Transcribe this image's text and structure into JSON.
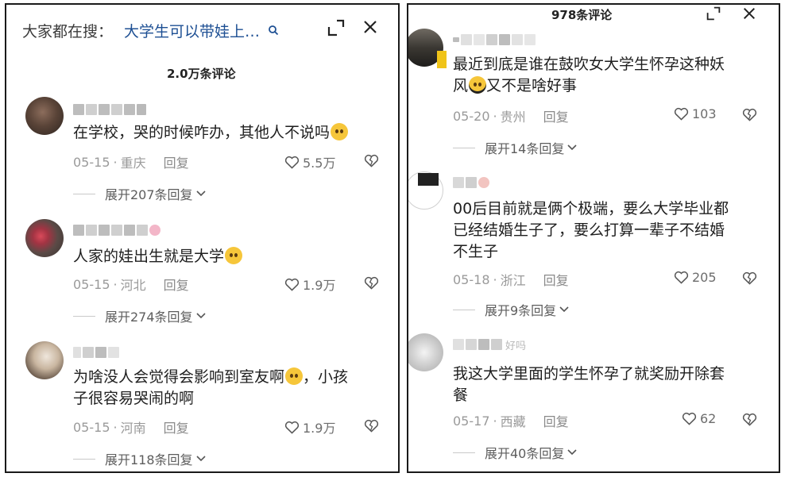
{
  "left": {
    "search_label": "大家都在搜：",
    "search_query": "大学生可以带娃上…",
    "comment_count": "2.0万条评论",
    "comments": [
      {
        "text": "在学校，哭的时候咋办，其他人不说吗",
        "emoji": "pleading-face-emoji",
        "date": "05-15",
        "sep": "·",
        "location": "重庆",
        "reply": "回复",
        "likes": "5.5万",
        "expand": "展开207条回复"
      },
      {
        "text": "人家的娃出生就是大学",
        "emoji": "crying-laughing-emoji",
        "date": "05-15",
        "sep": "·",
        "location": "河北",
        "reply": "回复",
        "likes": "1.9万",
        "expand": "展开274条回复"
      },
      {
        "text_line1": "为啥没人会觉得会影响到室友啊",
        "text_after_emoji": "，小孩",
        "text_line2": "子很容易哭闹的啊",
        "emoji": "dizzy-face-emoji",
        "date": "05-15",
        "sep": "·",
        "location": "河南",
        "reply": "回复",
        "likes": "1.9万",
        "expand": "展开118条回复"
      }
    ]
  },
  "right": {
    "comment_count": "978条评论",
    "comments": [
      {
        "text_line1": "最近到底是谁在鼓吹女大学生怀孕这种妖",
        "text_line2_before": "风",
        "text_line2_after": "又不是啥好事",
        "emoji": "headphone-face-emoji",
        "date": "05-20",
        "sep": "·",
        "location": "贵州",
        "reply": "回复",
        "likes": "103",
        "expand": "展开14条回复"
      },
      {
        "text_line1": "00后目前就是俩个极端，要么大学毕业都",
        "text_line2": "已经结婚生子了，要么打算一辈子不结婚",
        "text_line3": "不生子",
        "date": "05-18",
        "sep": "·",
        "location": "浙江",
        "reply": "回复",
        "likes": "205",
        "expand": "展开9条回复"
      },
      {
        "username_fragment": "好吗",
        "text_line1": "我这大学里面的学生怀孕了就奖励开除套",
        "text_line2": "餐",
        "date": "05-17",
        "sep": "·",
        "location": "西藏",
        "reply": "回复",
        "likes": "62",
        "expand": "展开40条回复"
      }
    ]
  },
  "colors": {
    "query_blue": "#1d4f93",
    "meta_gray": "#9a9a9a",
    "text": "#1e1e1e",
    "border": "#1a1a1a"
  }
}
